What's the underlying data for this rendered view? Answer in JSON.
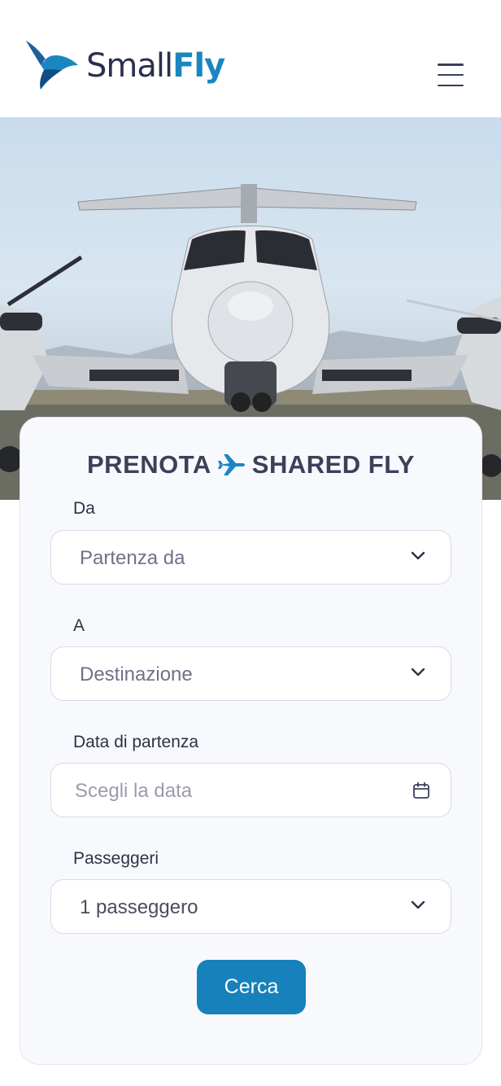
{
  "header": {
    "logo_small": "Small",
    "logo_fly": "Fly",
    "logo_icon": "hummingbird-logo",
    "menu_icon": "hamburger-menu-icon"
  },
  "hero": {
    "image": "turboprop-aircraft-front-view"
  },
  "booking": {
    "title_left": "PRENOTA",
    "title_icon": "airplane-icon",
    "title_right": "SHARED FLY",
    "from": {
      "label": "Da",
      "value": "Partenza da"
    },
    "to": {
      "label": "A",
      "value": "Destinazione"
    },
    "date": {
      "label": "Data di partenza",
      "placeholder": "Scegli la data",
      "icon": "calendar-icon"
    },
    "passengers": {
      "label": "Passeggeri",
      "value": "1 passeggero"
    },
    "search_label": "Cerca"
  },
  "colors": {
    "brand_dark": "#2a2f4e",
    "brand_blue": "#1a86c0",
    "button": "#1681ba",
    "card_bg": "#f7f9fc"
  }
}
